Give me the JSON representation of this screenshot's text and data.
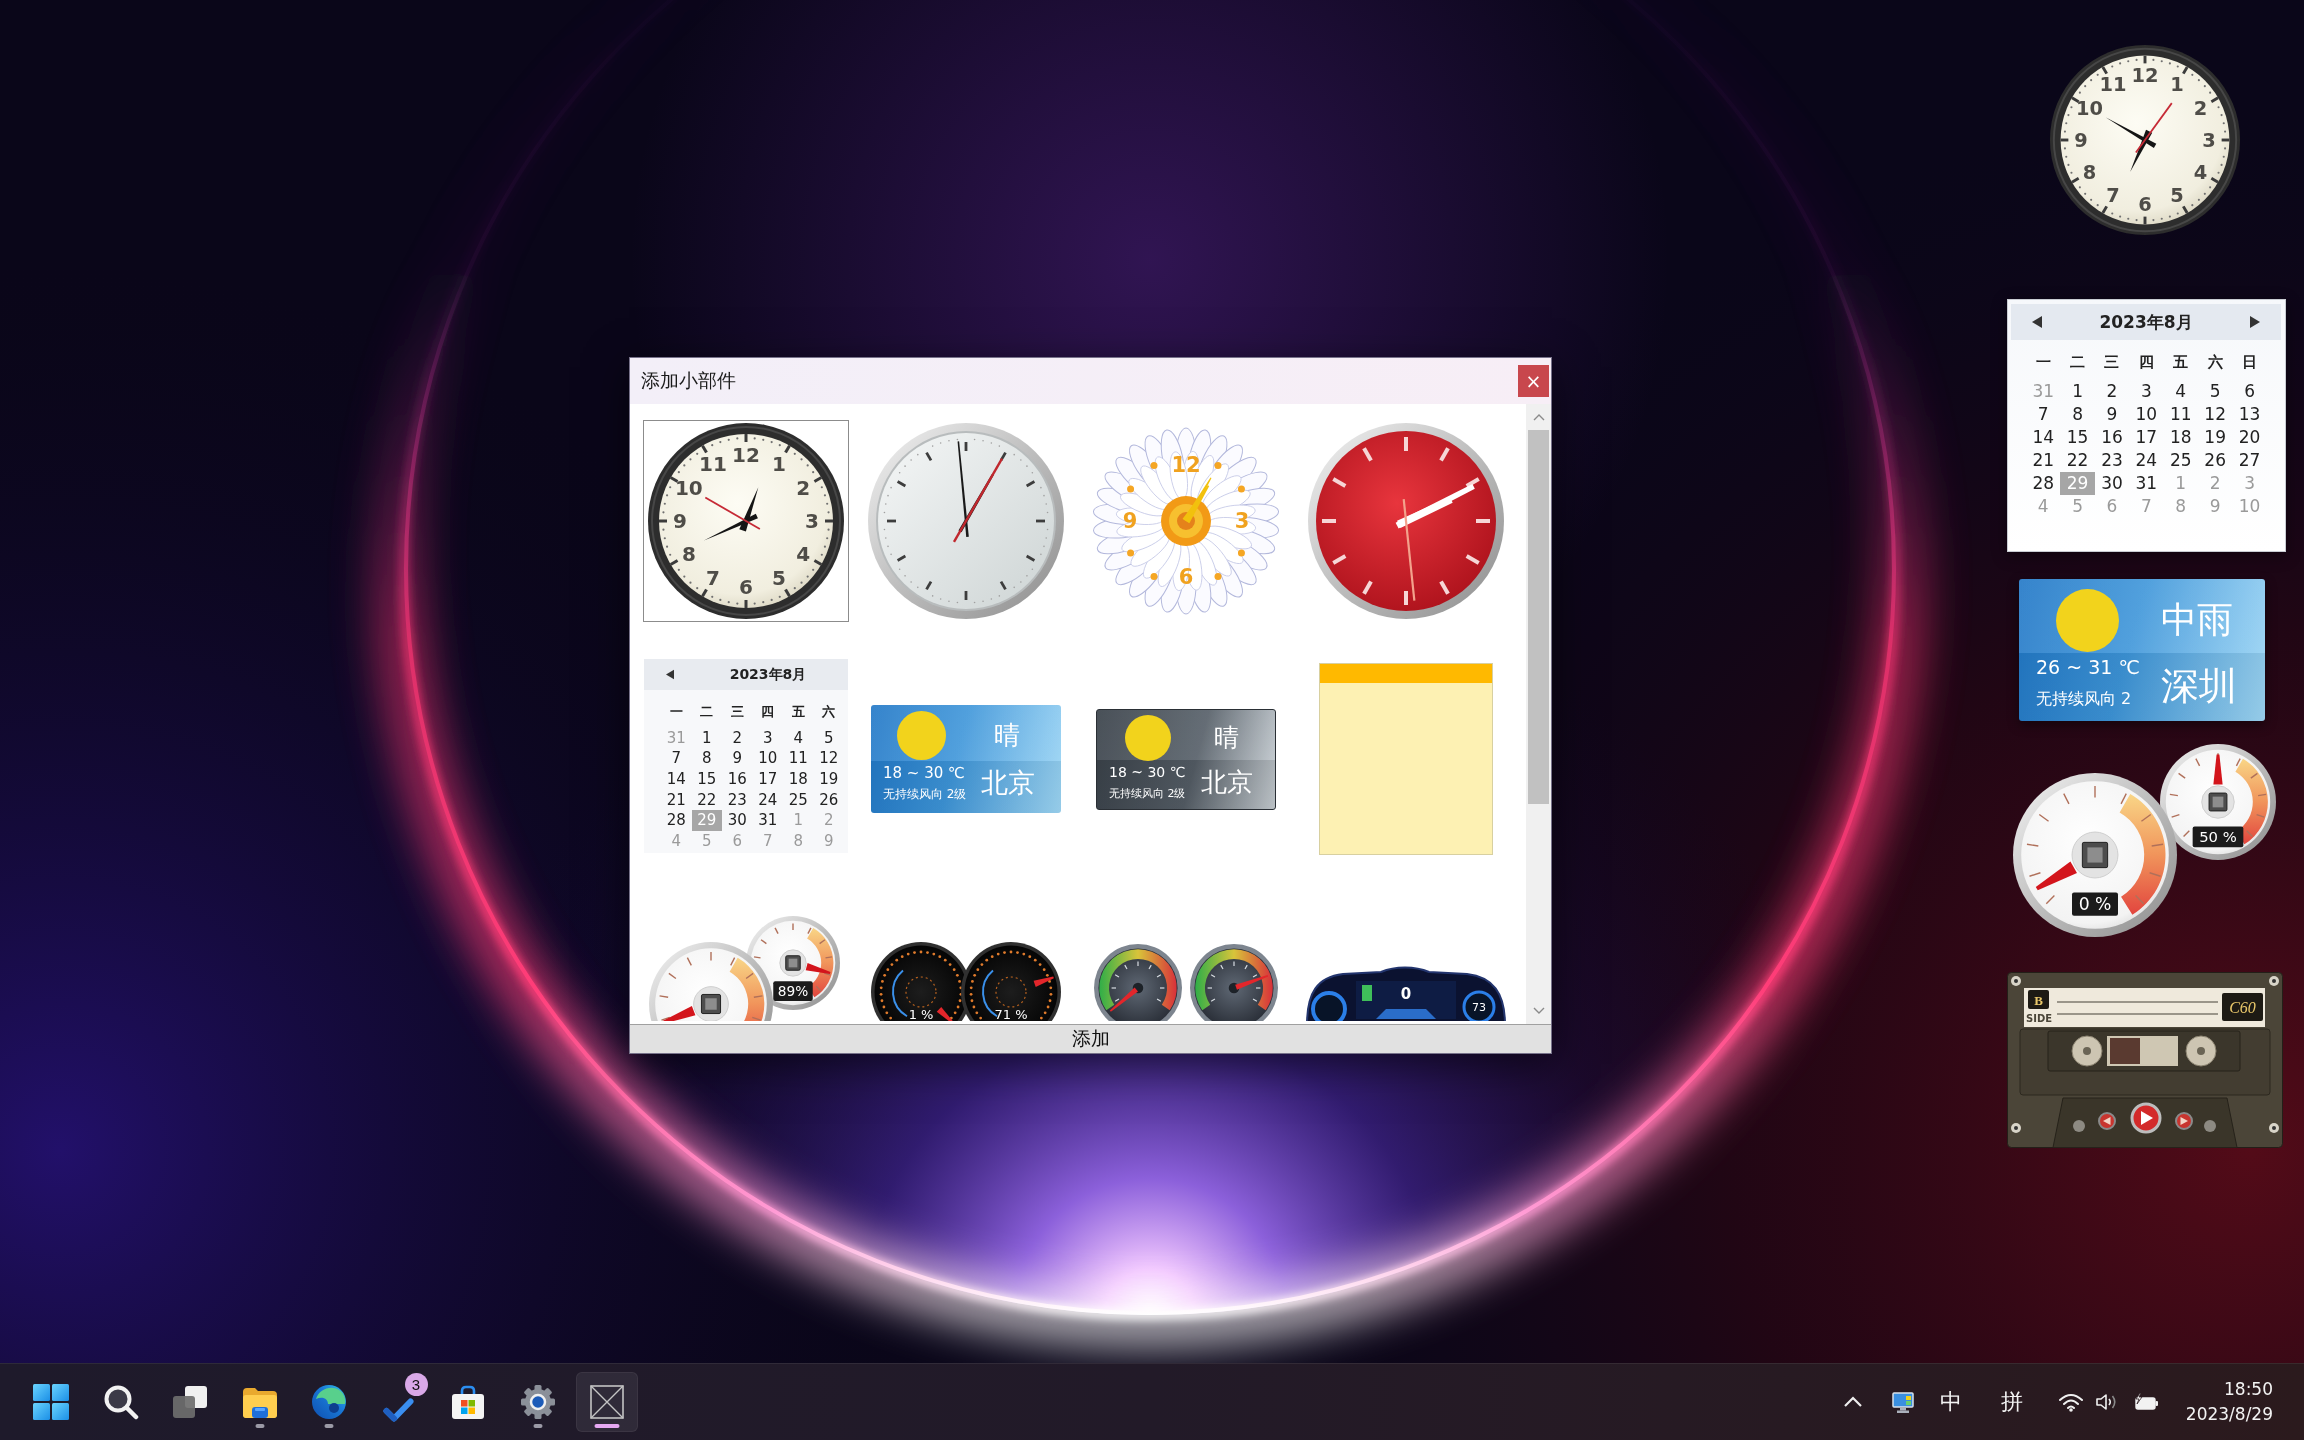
{
  "desktop_widgets": {
    "clock": {
      "kind": "classic-clock",
      "numerals": [
        "11",
        "12",
        "1",
        "10",
        "2",
        "9",
        "3",
        "8",
        "4",
        "7",
        "6",
        "5"
      ]
    },
    "calendar": {
      "title": "2023年8月",
      "weekdays": [
        "一",
        "二",
        "三",
        "四",
        "五",
        "六",
        "日"
      ],
      "weeks": [
        [
          {
            "day": "31",
            "muted": true,
            "selected": false
          },
          {
            "day": "1",
            "muted": false,
            "selected": false
          },
          {
            "day": "2",
            "muted": false,
            "selected": false
          },
          {
            "day": "3",
            "muted": false,
            "selected": false
          },
          {
            "day": "4",
            "muted": false,
            "selected": false
          },
          {
            "day": "5",
            "muted": false,
            "selected": false
          },
          {
            "day": "6",
            "muted": false,
            "selected": false
          }
        ],
        [
          {
            "day": "7",
            "muted": false,
            "selected": false
          },
          {
            "day": "8",
            "muted": false,
            "selected": false
          },
          {
            "day": "9",
            "muted": false,
            "selected": false
          },
          {
            "day": "10",
            "muted": false,
            "selected": false
          },
          {
            "day": "11",
            "muted": false,
            "selected": false
          },
          {
            "day": "12",
            "muted": false,
            "selected": false
          },
          {
            "day": "13",
            "muted": false,
            "selected": false
          }
        ],
        [
          {
            "day": "14",
            "muted": false,
            "selected": false
          },
          {
            "day": "15",
            "muted": false,
            "selected": false
          },
          {
            "day": "16",
            "muted": false,
            "selected": false
          },
          {
            "day": "17",
            "muted": false,
            "selected": false
          },
          {
            "day": "18",
            "muted": false,
            "selected": false
          },
          {
            "day": "19",
            "muted": false,
            "selected": false
          },
          {
            "day": "20",
            "muted": false,
            "selected": false
          }
        ],
        [
          {
            "day": "21",
            "muted": false,
            "selected": false
          },
          {
            "day": "22",
            "muted": false,
            "selected": false
          },
          {
            "day": "23",
            "muted": false,
            "selected": false
          },
          {
            "day": "24",
            "muted": false,
            "selected": false
          },
          {
            "day": "25",
            "muted": false,
            "selected": false
          },
          {
            "day": "26",
            "muted": false,
            "selected": false
          },
          {
            "day": "27",
            "muted": false,
            "selected": false
          }
        ],
        [
          {
            "day": "28",
            "muted": false,
            "selected": false
          },
          {
            "day": "29",
            "muted": false,
            "selected": true
          },
          {
            "day": "30",
            "muted": false,
            "selected": false
          },
          {
            "day": "31",
            "muted": false,
            "selected": false
          },
          {
            "day": "1",
            "muted": true,
            "selected": false
          },
          {
            "day": "2",
            "muted": true,
            "selected": false
          },
          {
            "day": "3",
            "muted": true,
            "selected": false
          }
        ],
        [
          {
            "day": "4",
            "muted": true,
            "selected": false
          },
          {
            "day": "5",
            "muted": true,
            "selected": false
          },
          {
            "day": "6",
            "muted": true,
            "selected": false
          },
          {
            "day": "7",
            "muted": true,
            "selected": false
          },
          {
            "day": "8",
            "muted": true,
            "selected": false
          },
          {
            "day": "9",
            "muted": true,
            "selected": false
          },
          {
            "day": "10",
            "muted": true,
            "selected": false
          }
        ]
      ]
    },
    "weather": {
      "condition": "中雨",
      "temperature": "26 ~ 31 ℃",
      "wind": "无持续风向 2",
      "city": "深圳"
    },
    "meters": [
      {
        "kind": "large",
        "reading": "0 %"
      },
      {
        "kind": "small",
        "reading": "50 %"
      }
    ],
    "cassette": {
      "side": "B",
      "side_label": "SIDE",
      "tape": "C60"
    }
  },
  "dialog": {
    "title": "添加小部件",
    "close": "×",
    "widgets": [
      {
        "kind": "classic-clock",
        "selected": true,
        "numerals": [
          "11",
          "12",
          "1",
          "10",
          "2",
          "9",
          "3",
          "8",
          "4",
          "7",
          "6",
          "5"
        ]
      },
      {
        "kind": "silver-clock",
        "selected": false
      },
      {
        "kind": "daisy-clock",
        "selected": false,
        "numerals": [
          "12",
          "9",
          "3",
          "6"
        ]
      },
      {
        "kind": "red-clock",
        "selected": false
      },
      {
        "kind": "calendar",
        "selected": false,
        "title": "2023年8月",
        "weekdays": [
          "一",
          "二",
          "三",
          "四",
          "五",
          "六"
        ],
        "weeks": [
          [
            {
              "day": "31",
              "muted": true,
              "selected": false
            },
            {
              "day": "1",
              "muted": false,
              "selected": false
            },
            {
              "day": "2",
              "muted": false,
              "selected": false
            },
            {
              "day": "3",
              "muted": false,
              "selected": false
            },
            {
              "day": "4",
              "muted": false,
              "selected": false
            },
            {
              "day": "5",
              "muted": false,
              "selected": false
            }
          ],
          [
            {
              "day": "7",
              "muted": false,
              "selected": false
            },
            {
              "day": "8",
              "muted": false,
              "selected": false
            },
            {
              "day": "9",
              "muted": false,
              "selected": false
            },
            {
              "day": "10",
              "muted": false,
              "selected": false
            },
            {
              "day": "11",
              "muted": false,
              "selected": false
            },
            {
              "day": "12",
              "muted": false,
              "selected": false
            }
          ],
          [
            {
              "day": "14",
              "muted": false,
              "selected": false
            },
            {
              "day": "15",
              "muted": false,
              "selected": false
            },
            {
              "day": "16",
              "muted": false,
              "selected": false
            },
            {
              "day": "17",
              "muted": false,
              "selected": false
            },
            {
              "day": "18",
              "muted": false,
              "selected": false
            },
            {
              "day": "19",
              "muted": false,
              "selected": false
            }
          ],
          [
            {
              "day": "21",
              "muted": false,
              "selected": false
            },
            {
              "day": "22",
              "muted": false,
              "selected": false
            },
            {
              "day": "23",
              "muted": false,
              "selected": false
            },
            {
              "day": "24",
              "muted": false,
              "selected": false
            },
            {
              "day": "25",
              "muted": false,
              "selected": false
            },
            {
              "day": "26",
              "muted": false,
              "selected": false
            }
          ],
          [
            {
              "day": "28",
              "muted": false,
              "selected": false
            },
            {
              "day": "29",
              "muted": false,
              "selected": true
            },
            {
              "day": "30",
              "muted": false,
              "selected": false
            },
            {
              "day": "31",
              "muted": false,
              "selected": false
            },
            {
              "day": "1",
              "muted": true,
              "selected": false
            },
            {
              "day": "2",
              "muted": true,
              "selected": false
            }
          ],
          [
            {
              "day": "4",
              "muted": true,
              "selected": false
            },
            {
              "day": "5",
              "muted": true,
              "selected": false
            },
            {
              "day": "6",
              "muted": true,
              "selected": false
            },
            {
              "day": "7",
              "muted": true,
              "selected": false
            },
            {
              "day": "8",
              "muted": true,
              "selected": false
            },
            {
              "day": "9",
              "muted": true,
              "selected": false
            }
          ]
        ]
      },
      {
        "kind": "blue-weather",
        "selected": false,
        "condition": "晴",
        "temperature": "18 ~ 30 ℃",
        "wind": "无持续风向 2级",
        "city": "北京"
      },
      {
        "kind": "dark-weather",
        "selected": false,
        "condition": "晴",
        "temperature": "18 ~ 30 ℃",
        "wind": "无持续风向 2级",
        "city": "北京"
      },
      {
        "kind": "sticky-note",
        "selected": false
      },
      {
        "kind": "cpu-meters",
        "selected": false,
        "meters": [
          {
            "kind": "large"
          },
          {
            "kind": "small",
            "reading": "89%"
          }
        ]
      },
      {
        "kind": "dark-meters",
        "selected": false,
        "meters": [
          {
            "reading": "1 %"
          },
          {
            "reading": "71 %"
          }
        ]
      },
      {
        "kind": "green-meters",
        "selected": false
      },
      {
        "kind": "car-dashboard",
        "selected": false,
        "readings": [
          "0",
          "73"
        ]
      }
    ],
    "add_button": "添加"
  },
  "taskbar": {
    "apps": [
      {
        "kind": "start",
        "running": false,
        "selected": false
      },
      {
        "kind": "search",
        "running": false,
        "selected": false
      },
      {
        "kind": "task-view",
        "running": false,
        "selected": false
      },
      {
        "kind": "folder",
        "running": true,
        "selected": false
      },
      {
        "kind": "browser",
        "running": true,
        "selected": false
      },
      {
        "kind": "todo",
        "running": false,
        "selected": false,
        "badge": "3"
      },
      {
        "kind": "store",
        "running": false,
        "selected": false
      },
      {
        "kind": "settings",
        "running": true,
        "selected": false
      },
      {
        "kind": "widgets-app",
        "running": true,
        "selected": true
      }
    ],
    "tray": {
      "input_mode": "中",
      "ime": "拼"
    },
    "clock": {
      "time": "18:50",
      "date": "2023/8/29"
    }
  }
}
